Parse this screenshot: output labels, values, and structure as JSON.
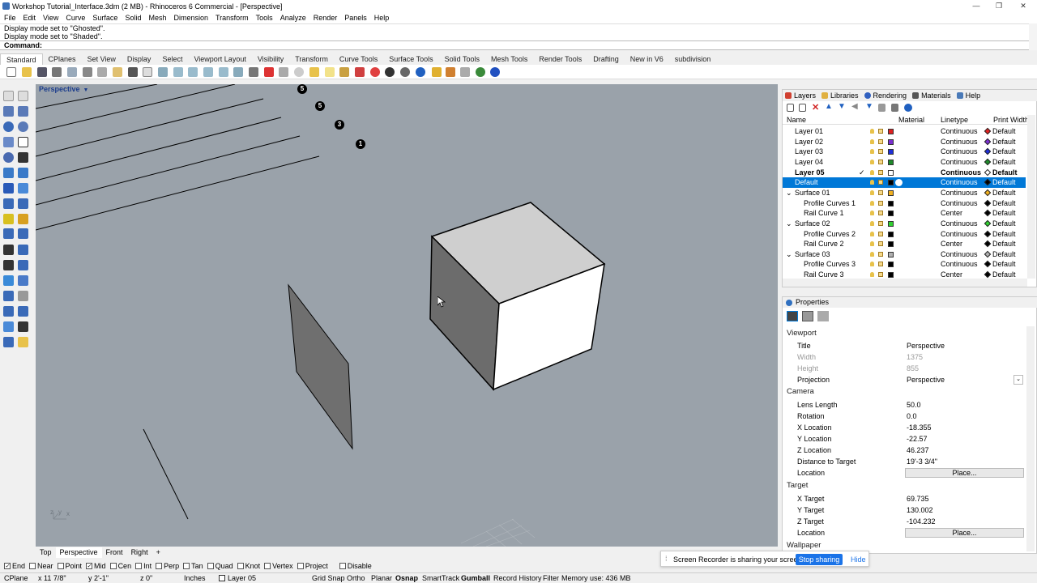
{
  "window": {
    "title": "Workshop Tutorial_Interface.3dm (2 MB) - Rhinoceros 6 Commercial - [Perspective]",
    "min": "—",
    "max": "❐",
    "close": "✕"
  },
  "menu": [
    "File",
    "Edit",
    "View",
    "Curve",
    "Surface",
    "Solid",
    "Mesh",
    "Dimension",
    "Transform",
    "Tools",
    "Analyze",
    "Render",
    "Panels",
    "Help"
  ],
  "command": {
    "history": [
      "Display mode set to \"Ghosted\".",
      "Display mode set to \"Shaded\"."
    ],
    "prompt": "Command:"
  },
  "toolbar_tabs": [
    "Standard",
    "CPlanes",
    "Set View",
    "Display",
    "Select",
    "Viewport Layout",
    "Visibility",
    "Transform",
    "Curve Tools",
    "Surface Tools",
    "Solid Tools",
    "Mesh Tools",
    "Render Tools",
    "Drafting",
    "New in V6",
    "subdivision"
  ],
  "viewport": {
    "label": "Perspective",
    "markers": [
      "5",
      "5",
      "3",
      "1"
    ],
    "axis_y": "y",
    "axis_x": "x",
    "axis_z": "z"
  },
  "viewport_tabs": [
    "Top",
    "Perspective",
    "Front",
    "Right",
    "+"
  ],
  "panels": {
    "tabs": [
      "Layers",
      "Libraries",
      "Rendering",
      "Materials",
      "Help"
    ],
    "layer_columns": {
      "name": "Name",
      "material": "Material",
      "linetype": "Linetype",
      "print_width": "Print Width"
    },
    "layers": [
      {
        "name": "Layer 01",
        "color": "#e02020",
        "linetype": "Continuous",
        "print_color": "#e02020",
        "print_width": "Default"
      },
      {
        "name": "Layer 02",
        "color": "#7a2fd0",
        "linetype": "Continuous",
        "print_color": "#7a2fd0",
        "print_width": "Default"
      },
      {
        "name": "Layer 03",
        "color": "#1f2fd8",
        "linetype": "Continuous",
        "print_color": "#1f2fd8",
        "print_width": "Default"
      },
      {
        "name": "Layer 04",
        "color": "#1e8a2a",
        "linetype": "Continuous",
        "print_color": "#1e8a2a",
        "print_width": "Default"
      },
      {
        "name": "Layer 05",
        "color": "#ffffff",
        "linetype": "Continuous",
        "print_color": "#ffffff",
        "print_width": "Default",
        "check": "✓",
        "bold": true
      },
      {
        "name": "Default",
        "color": "#000000",
        "linetype": "Continuous",
        "print_color": "#000000",
        "print_width": "Default",
        "selected": true
      },
      {
        "name": "Surface 01",
        "color": "#f0b020",
        "linetype": "Continuous",
        "print_color": "#f0b020",
        "print_width": "Default",
        "expander": "⌄"
      },
      {
        "name": "Profile Curves 1",
        "color": "#000000",
        "linetype": "Continuous",
        "print_color": "#000000",
        "print_width": "Default",
        "child": true
      },
      {
        "name": "Rail Curve 1",
        "color": "#000000",
        "linetype": "Center",
        "print_color": "#000000",
        "print_width": "Default",
        "child": true
      },
      {
        "name": "Surface  02",
        "color": "#30d030",
        "linetype": "Continuous",
        "print_color": "#30d030",
        "print_width": "Default",
        "expander": "⌄"
      },
      {
        "name": "Profile Curves 2",
        "color": "#000000",
        "linetype": "Continuous",
        "print_color": "#000000",
        "print_width": "Default",
        "child": true
      },
      {
        "name": "Rail Curve 2",
        "color": "#000000",
        "linetype": "Center",
        "print_color": "#000000",
        "print_width": "Default",
        "child": true
      },
      {
        "name": "Surface  03",
        "color": "#b0b0b0",
        "linetype": "Continuous",
        "print_color": "#b0b0b0",
        "print_width": "Default",
        "expander": "⌄"
      },
      {
        "name": "Profile Curves 3",
        "color": "#000000",
        "linetype": "Continuous",
        "print_color": "#000000",
        "print_width": "Default",
        "child": true
      },
      {
        "name": "Rail Curve 3",
        "color": "#000000",
        "linetype": "Center",
        "print_color": "#000000",
        "print_width": "Default",
        "child": true
      }
    ]
  },
  "properties": {
    "title": "Properties",
    "viewport_section": "Viewport",
    "title_label": "Title",
    "title_value": "Perspective",
    "width_label": "Width",
    "width_value": "1375",
    "height_label": "Height",
    "height_value": "855",
    "projection_label": "Projection",
    "projection_value": "Perspective",
    "camera_section": "Camera",
    "lens_label": "Lens Length",
    "lens_value": "50.0",
    "rotation_label": "Rotation",
    "rotation_value": "0.0",
    "xloc_label": "X Location",
    "xloc_value": "-18.355",
    "yloc_label": "Y Location",
    "yloc_value": "-22.57",
    "zloc_label": "Z Location",
    "zloc_value": "46.237",
    "dist_label": "Distance to Target",
    "dist_value": "19'-3 3/4\"",
    "location_label": "Location",
    "place": "Place...",
    "target_section": "Target",
    "xt_label": "X Target",
    "xt_value": "69.735",
    "yt_label": "Y Target",
    "yt_value": "130.002",
    "zt_label": "Z Target",
    "zt_value": "-104.232",
    "wallpaper_section": "Wallpaper"
  },
  "osnaps": [
    {
      "label": "End",
      "checked": true
    },
    {
      "label": "Near",
      "checked": false
    },
    {
      "label": "Point",
      "checked": false
    },
    {
      "label": "Mid",
      "checked": true
    },
    {
      "label": "Cen",
      "checked": false
    },
    {
      "label": "Int",
      "checked": false
    },
    {
      "label": "Perp",
      "checked": false
    },
    {
      "label": "Tan",
      "checked": false
    },
    {
      "label": "Quad",
      "checked": false
    },
    {
      "label": "Knot",
      "checked": false
    },
    {
      "label": "Vertex",
      "checked": false
    },
    {
      "label": "Project",
      "checked": false
    },
    {
      "label": "Disable",
      "checked": false
    }
  ],
  "status": {
    "cplane": "CPlane",
    "x": "x 11 7/8\"",
    "y": "y 2'-1\"",
    "z": "z 0\"",
    "units": "Inches",
    "layer": "Layer 05",
    "grid_snap": "Grid Snap",
    "ortho": "Ortho",
    "planar": "Planar",
    "osnap": "Osnap",
    "smarttrack": "SmartTrack",
    "gumball": "Gumball",
    "record": "Record History",
    "filter": "Filter",
    "memory": "Memory use: 436 MB"
  },
  "notification": {
    "message": "Screen Recorder is sharing your screen.",
    "stop": "Stop sharing",
    "hide": "Hide"
  }
}
